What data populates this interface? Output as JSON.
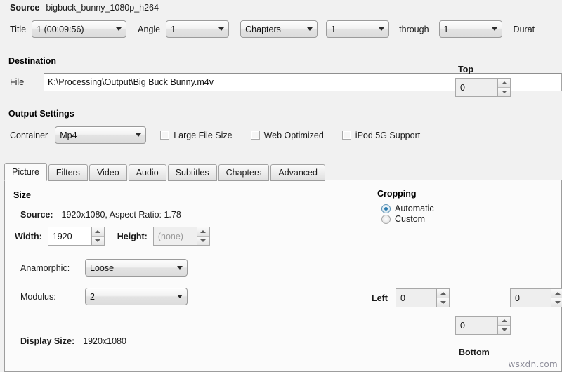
{
  "source": {
    "label": "Source",
    "filename": "bigbuck_bunny_1080p_h264"
  },
  "title_row": {
    "title_label": "Title",
    "title_value": "1 (00:09:56)",
    "angle_label": "Angle",
    "angle_value": "1",
    "range_type_value": "Chapters",
    "range_from_value": "1",
    "through_label": "through",
    "range_to_value": "1",
    "duration_label": "Durat"
  },
  "destination": {
    "section_label": "Destination",
    "file_label": "File",
    "file_value": "K:\\Processing\\Output\\Big Buck Bunny.m4v"
  },
  "output_settings": {
    "section_label": "Output Settings",
    "container_label": "Container",
    "container_value": "Mp4",
    "checkboxes": [
      {
        "label": "Large File Size",
        "checked": false
      },
      {
        "label": "Web Optimized",
        "checked": false
      },
      {
        "label": "iPod 5G Support",
        "checked": false
      }
    ]
  },
  "tabs": [
    {
      "label": "Picture",
      "active": true
    },
    {
      "label": "Filters",
      "active": false
    },
    {
      "label": "Video",
      "active": false
    },
    {
      "label": "Audio",
      "active": false
    },
    {
      "label": "Subtitles",
      "active": false
    },
    {
      "label": "Chapters",
      "active": false
    },
    {
      "label": "Advanced",
      "active": false
    }
  ],
  "picture": {
    "size": {
      "section_label": "Size",
      "source_label": "Source:",
      "source_value": "1920x1080, Aspect Ratio: 1.78",
      "width_label": "Width:",
      "width_value": "1920",
      "height_label": "Height:",
      "height_value": "(none)",
      "anamorphic_label": "Anamorphic:",
      "anamorphic_value": "Loose",
      "modulus_label": "Modulus:",
      "modulus_value": "2",
      "display_size_label": "Display Size:",
      "display_size_value": "1920x1080"
    },
    "cropping": {
      "section_label": "Cropping",
      "mode_automatic": "Automatic",
      "mode_custom": "Custom",
      "automatic_selected": true,
      "top_label": "Top",
      "top_value": "0",
      "left_label": "Left",
      "left_value": "0",
      "right_value": "0",
      "bottom_label": "Bottom",
      "bottom_value": "0"
    }
  },
  "watermark": "wsxdn.com",
  "colors": {
    "window_background": "#f1f1f1",
    "panel_background": "#fbfbfb",
    "border": "#9d9d9d",
    "radio_accent": "#2b7cb0",
    "text": "#101010"
  }
}
